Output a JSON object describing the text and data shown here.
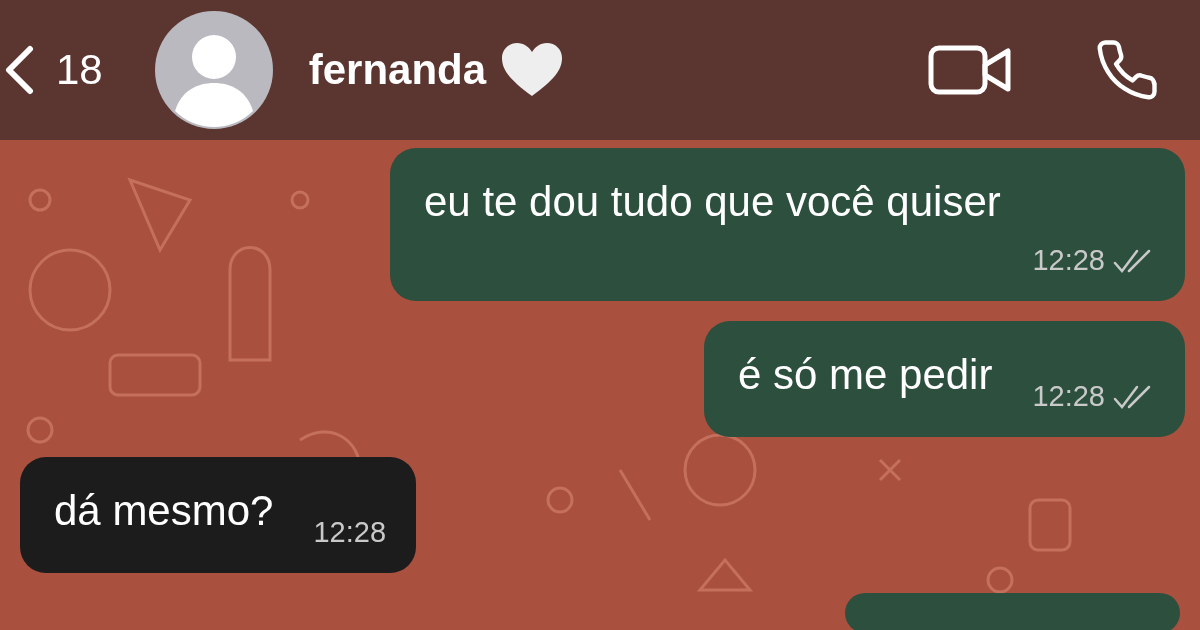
{
  "header": {
    "back_count": "18",
    "contact_name": "fernanda"
  },
  "messages": [
    {
      "kind": "text",
      "outgoing": true,
      "text": "eu te dou tudo que você quiser",
      "time": "12:28",
      "read": true
    },
    {
      "kind": "text",
      "outgoing": true,
      "text": "é só me pedir",
      "time": "12:28",
      "read": true
    },
    {
      "kind": "text",
      "outgoing": false,
      "text": "dá mesmo?",
      "time": "12:28"
    },
    {
      "kind": "cut-off",
      "outgoing": true
    }
  ]
}
